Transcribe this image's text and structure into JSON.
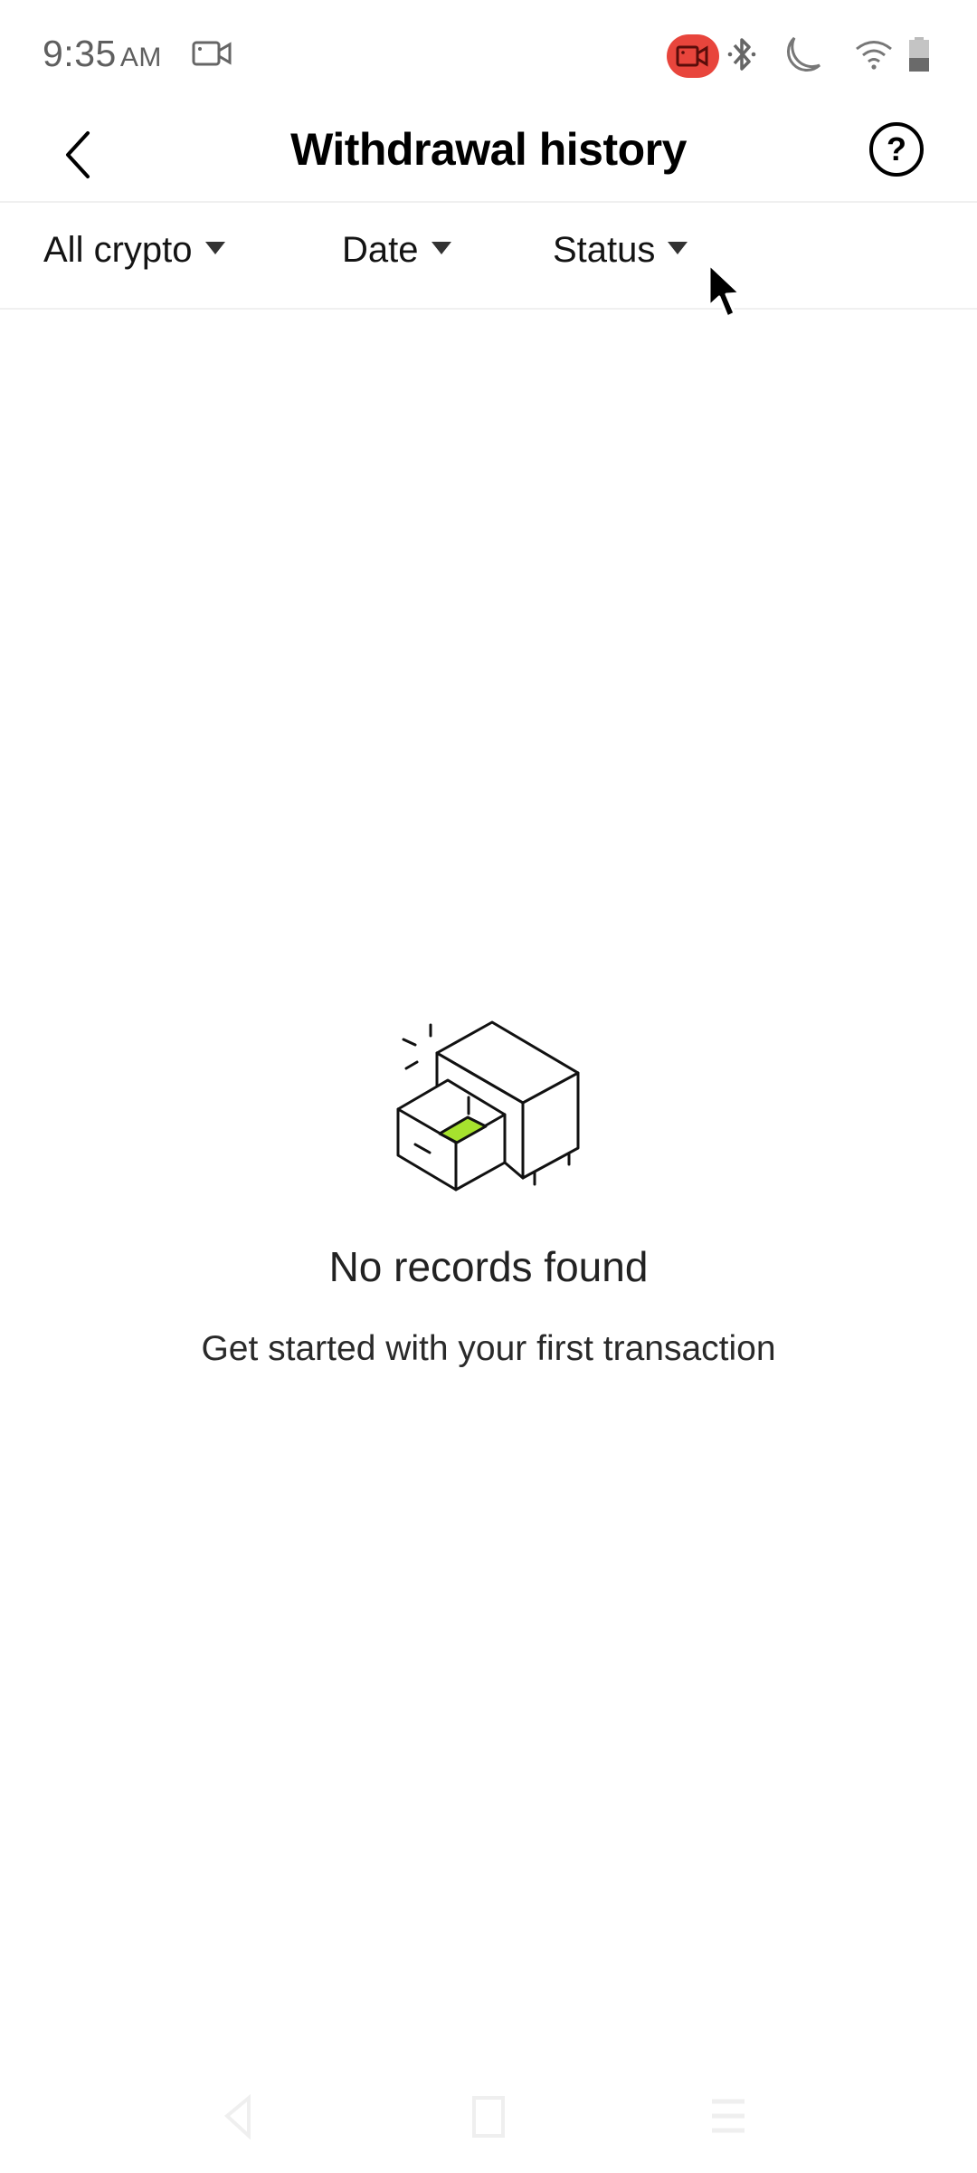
{
  "status_bar": {
    "time": "9:35",
    "ampm": "AM",
    "icons": [
      "screen-record-icon",
      "recording-indicator-icon",
      "bluetooth-icon",
      "do-not-disturb-moon-icon",
      "wifi-icon",
      "battery-icon"
    ],
    "recording_color": "#e8453c"
  },
  "header": {
    "title": "Withdrawal history",
    "back_icon": "chevron-left-icon",
    "help_label": "?"
  },
  "filters": [
    {
      "label": "All crypto"
    },
    {
      "label": "Date"
    },
    {
      "label": "Status"
    }
  ],
  "empty_state": {
    "title": "No records found",
    "subtitle": "Get started with your first transaction",
    "illustration": "open-drawer-cabinet",
    "accent_color": "#a6e22e"
  },
  "nav_bar": {
    "buttons": [
      "back",
      "home",
      "recents"
    ]
  }
}
